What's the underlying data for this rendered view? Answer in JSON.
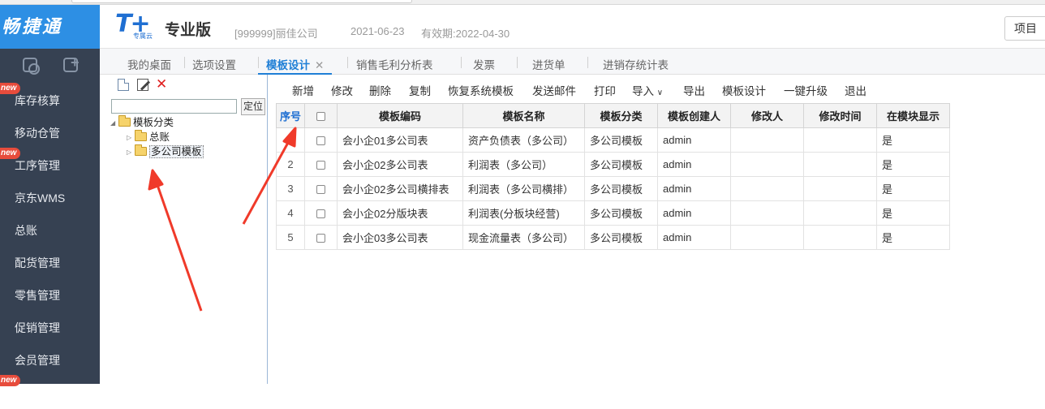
{
  "header": {
    "logo_text": "畅捷通",
    "brand_mark": "T+",
    "brand_sub": "专属云",
    "edition": "专业版",
    "company": "[999999]丽佳公司",
    "date": "2021-06-23",
    "expiry": "有效期:2022-04-30",
    "project_button": "项目"
  },
  "nav": {
    "items": [
      {
        "label": "库存核算",
        "badge": "new"
      },
      {
        "label": "移动仓管",
        "badge": ""
      },
      {
        "label": "工序管理",
        "badge": "new"
      },
      {
        "label": "京东WMS",
        "badge": ""
      },
      {
        "label": "总账",
        "badge": ""
      },
      {
        "label": "配货管理",
        "badge": ""
      },
      {
        "label": "零售管理",
        "badge": ""
      },
      {
        "label": "促销管理",
        "badge": ""
      },
      {
        "label": "会员管理",
        "badge": ""
      }
    ],
    "last_badge": "new"
  },
  "tabs": [
    {
      "label": "我的桌面"
    },
    {
      "label": "选项设置"
    },
    {
      "label": "模板设计",
      "active": true,
      "close": "✕"
    },
    {
      "label": "销售毛利分析表"
    },
    {
      "label": "发票"
    },
    {
      "label": "进货单"
    },
    {
      "label": "进销存统计表"
    }
  ],
  "tree": {
    "locate_button": "定位",
    "search_value": "",
    "root": "模板分类",
    "children": [
      "总账",
      "多公司模板"
    ],
    "selected": "多公司模板"
  },
  "toolbar": {
    "new": "新增",
    "modify": "修改",
    "delete": "删除",
    "copy": "复制",
    "restore": "恢复系统模板",
    "send_mail": "发送邮件",
    "print": "打印",
    "import": "导入",
    "export": "导出",
    "design": "模板设计",
    "upgrade": "一键升级",
    "exit": "退出"
  },
  "grid": {
    "columns": [
      "序号",
      "",
      "模板编码",
      "模板名称",
      "模板分类",
      "模板创建人",
      "修改人",
      "修改时间",
      "在模块显示"
    ],
    "rows": [
      {
        "no": "1",
        "code": "会小企01多公司表",
        "name": "资产负债表（多公司）",
        "category": "多公司模板",
        "creator": "admin",
        "modifier": "",
        "modified": "",
        "show": "是"
      },
      {
        "no": "2",
        "code": "会小企02多公司表",
        "name": "利润表（多公司）",
        "category": "多公司模板",
        "creator": "admin",
        "modifier": "",
        "modified": "",
        "show": "是"
      },
      {
        "no": "3",
        "code": "会小企02多公司横排表",
        "name": "利润表（多公司横排）",
        "category": "多公司模板",
        "creator": "admin",
        "modifier": "",
        "modified": "",
        "show": "是"
      },
      {
        "no": "4",
        "code": "会小企02分版块表",
        "name": "利润表(分板块经营)",
        "category": "多公司模板",
        "creator": "admin",
        "modifier": "",
        "modified": "",
        "show": "是"
      },
      {
        "no": "5",
        "code": "会小企03多公司表",
        "name": "现金流量表（多公司）",
        "category": "多公司模板",
        "creator": "admin",
        "modifier": "",
        "modified": "",
        "show": "是"
      }
    ]
  },
  "colors": {
    "logo_bg": "#2d8fe4",
    "nav_bg": "#364152",
    "accent": "#1f7fd6",
    "badge": "#e74c3c",
    "annotation_arrow": "#f03a2a"
  }
}
